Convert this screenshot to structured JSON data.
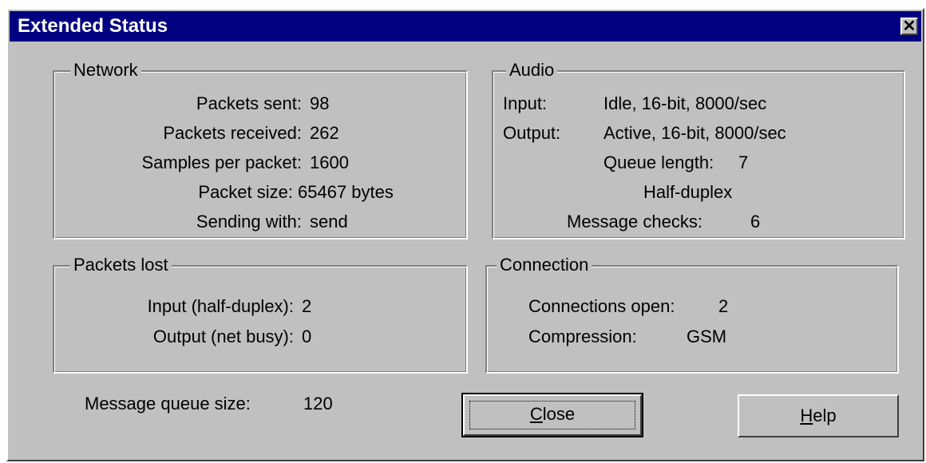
{
  "window": {
    "title": "Extended Status",
    "close_glyph": "✕"
  },
  "network": {
    "legend": "Network",
    "rows": [
      {
        "label": "Packets sent:",
        "value": "98"
      },
      {
        "label": "Packets received:",
        "value": "262"
      },
      {
        "label": "Samples per packet:",
        "value": "1600"
      },
      {
        "label": "Packet size:",
        "value": "65467 bytes"
      },
      {
        "label": "Sending with:",
        "value": "send"
      }
    ]
  },
  "audio": {
    "legend": "Audio",
    "input_label": "Input:",
    "input_value": "Idle, 16-bit, 8000/sec",
    "output_label": "Output:",
    "output_value": "Active, 16-bit, 8000/sec",
    "queue_length_label": "Queue length:",
    "queue_length_value": "7",
    "duplex": "Half-duplex",
    "message_checks_label": "Message checks:",
    "message_checks_value": "6"
  },
  "packets_lost": {
    "legend": "Packets lost",
    "input_label": "Input (half-duplex):",
    "input_value": "2",
    "output_label": "Output (net busy):",
    "output_value": "0"
  },
  "connection": {
    "legend": "Connection",
    "open_label": "Connections open:",
    "open_value": "2",
    "compression_label": "Compression:",
    "compression_value": "GSM"
  },
  "message_queue": {
    "label": "Message queue size:",
    "value": "120"
  },
  "buttons": {
    "close_mnemonic": "C",
    "close_rest": "lose",
    "help_mnemonic": "H",
    "help_rest": "elp"
  }
}
